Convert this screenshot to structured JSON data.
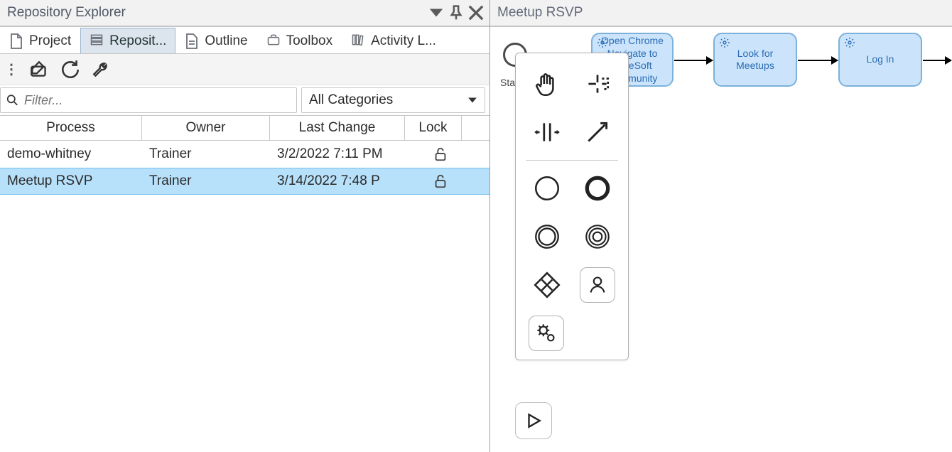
{
  "left_panel": {
    "title": "Repository Explorer",
    "tabs": [
      {
        "label": "Project",
        "active": false
      },
      {
        "label": "Reposit...",
        "active": true
      },
      {
        "label": "Outline",
        "active": false
      },
      {
        "label": "Toolbox",
        "active": false
      },
      {
        "label": "Activity L...",
        "active": false
      }
    ],
    "search_placeholder": "Filter...",
    "category_combo": "All Categories",
    "columns": {
      "process": "Process",
      "owner": "Owner",
      "last": "Last Change",
      "lock": "Lock"
    },
    "rows": [
      {
        "process": "demo-whitney",
        "owner": "Trainer",
        "last": "3/2/2022 7:11 PM",
        "locked": false,
        "selected": false
      },
      {
        "process": "Meetup RSVP",
        "owner": "Trainer",
        "last": "3/14/2022 7:48 P",
        "locked": false,
        "selected": true
      }
    ]
  },
  "right_panel": {
    "title": "Meetup RSVP",
    "start_label": "Start",
    "nodes": [
      {
        "line1": "Open Chrome",
        "line2": "Navigate to",
        "line3": "MuleSoft",
        "line4": "Community"
      },
      {
        "line1": "Look for",
        "line2": "Meetups"
      },
      {
        "line1": "Log In"
      }
    ]
  }
}
